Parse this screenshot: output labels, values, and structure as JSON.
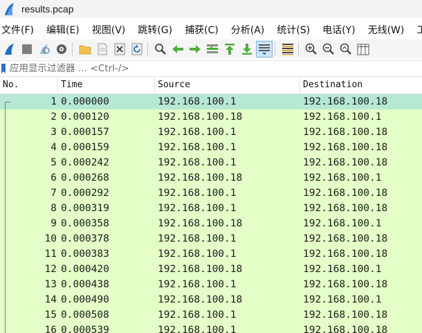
{
  "window": {
    "title": "results.pcap"
  },
  "menu": [
    "文件(F)",
    "编辑(E)",
    "视图(V)",
    "跳转(G)",
    "捕获(C)",
    "分析(A)",
    "统计(S)",
    "电话(Y)",
    "无线(W)",
    "工"
  ],
  "toolbar": [
    {
      "name": "start-capture-icon"
    },
    {
      "name": "stop-capture-icon"
    },
    {
      "name": "restart-capture-icon"
    },
    {
      "name": "capture-options-icon"
    },
    {
      "sep": true
    },
    {
      "name": "open-file-icon"
    },
    {
      "name": "save-file-icon"
    },
    {
      "name": "close-file-icon"
    },
    {
      "name": "reload-file-icon"
    },
    {
      "sep": true
    },
    {
      "name": "find-packet-icon"
    },
    {
      "name": "go-back-icon"
    },
    {
      "name": "go-forward-icon"
    },
    {
      "name": "go-to-packet-icon"
    },
    {
      "name": "go-first-packet-icon"
    },
    {
      "name": "go-last-packet-icon"
    },
    {
      "name": "auto-scroll-icon",
      "pressed": true
    },
    {
      "sep": true
    },
    {
      "name": "colorize-icon"
    },
    {
      "sep": true
    },
    {
      "name": "zoom-in-icon"
    },
    {
      "name": "zoom-out-icon"
    },
    {
      "name": "zoom-normal-icon"
    },
    {
      "name": "resize-columns-icon"
    }
  ],
  "filter": {
    "placeholder": "应用显示过滤器 … <Ctrl-/>"
  },
  "packet_list": {
    "columns": {
      "no": "No.",
      "time": "Time",
      "source": "Source",
      "destination": "Destination"
    },
    "rows": [
      {
        "no": "1",
        "time": "0.000000",
        "source": "192.168.100.1",
        "destination": "192.168.100.18",
        "selected": true
      },
      {
        "no": "2",
        "time": "0.000120",
        "source": "192.168.100.18",
        "destination": "192.168.100.1"
      },
      {
        "no": "3",
        "time": "0.000157",
        "source": "192.168.100.1",
        "destination": "192.168.100.18"
      },
      {
        "no": "4",
        "time": "0.000159",
        "source": "192.168.100.1",
        "destination": "192.168.100.18"
      },
      {
        "no": "5",
        "time": "0.000242",
        "source": "192.168.100.1",
        "destination": "192.168.100.18"
      },
      {
        "no": "6",
        "time": "0.000268",
        "source": "192.168.100.18",
        "destination": "192.168.100.1"
      },
      {
        "no": "7",
        "time": "0.000292",
        "source": "192.168.100.1",
        "destination": "192.168.100.18"
      },
      {
        "no": "8",
        "time": "0.000319",
        "source": "192.168.100.1",
        "destination": "192.168.100.18"
      },
      {
        "no": "9",
        "time": "0.000358",
        "source": "192.168.100.18",
        "destination": "192.168.100.1"
      },
      {
        "no": "10",
        "time": "0.000378",
        "source": "192.168.100.1",
        "destination": "192.168.100.18"
      },
      {
        "no": "11",
        "time": "0.000383",
        "source": "192.168.100.1",
        "destination": "192.168.100.18"
      },
      {
        "no": "12",
        "time": "0.000420",
        "source": "192.168.100.18",
        "destination": "192.168.100.1"
      },
      {
        "no": "13",
        "time": "0.000438",
        "source": "192.168.100.1",
        "destination": "192.168.100.18"
      },
      {
        "no": "14",
        "time": "0.000490",
        "source": "192.168.100.18",
        "destination": "192.168.100.1"
      },
      {
        "no": "15",
        "time": "0.000508",
        "source": "192.168.100.1",
        "destination": "192.168.100.18"
      },
      {
        "no": "16",
        "time": "0.000539",
        "source": "192.168.100.1",
        "destination": "192.168.100.18"
      }
    ]
  },
  "colors": {
    "row_bg": "#e4ffc7",
    "selected_row_bg": "#b6e8d4",
    "toolbar_blue": "#1f6fc4",
    "toolbar_green": "#4caf3a"
  }
}
